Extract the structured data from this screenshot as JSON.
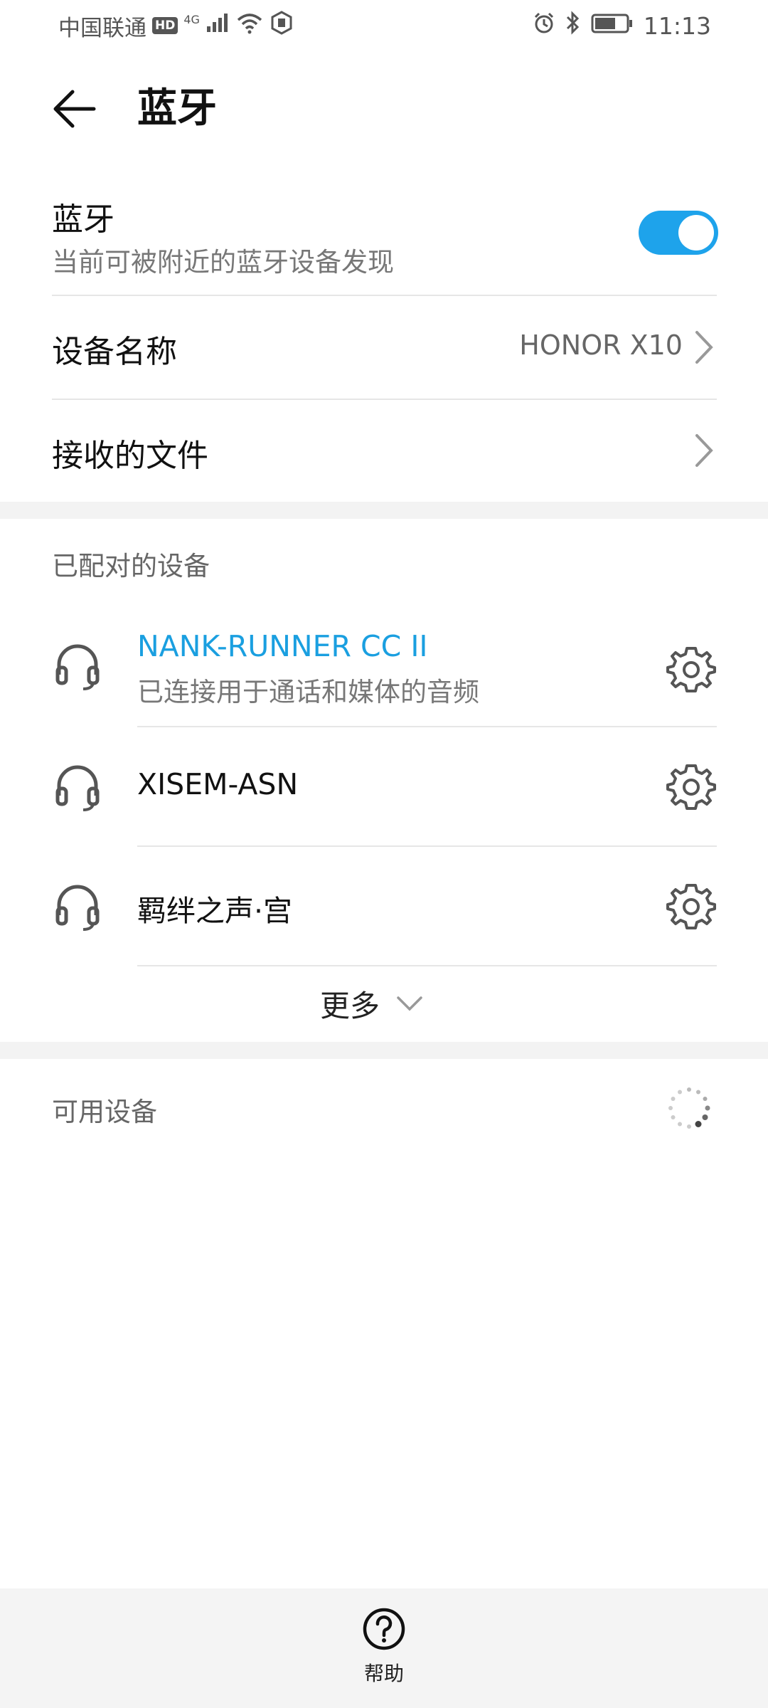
{
  "status_bar": {
    "carrier": "中国联通",
    "hd": "HD",
    "network": "4G",
    "time": "11:13",
    "icons": [
      "signal-icon",
      "wifi-icon",
      "hotspot-icon",
      "alarm-icon",
      "bluetooth-icon",
      "battery-icon"
    ]
  },
  "header": {
    "title": "蓝牙",
    "back_icon": "arrow-left-icon"
  },
  "bluetooth": {
    "label": "蓝牙",
    "subtitle": "当前可被附近的蓝牙设备发现",
    "enabled": true,
    "accent_color": "#1ea3eb"
  },
  "settings": {
    "device_name_label": "设备名称",
    "device_name_value": "HONOR X10",
    "received_files_label": "接收的文件"
  },
  "paired": {
    "header": "已配对的设备",
    "devices": [
      {
        "name": "NANK-RUNNER CC II",
        "status": "已连接用于通话和媒体的音频",
        "icon": "headset-icon"
      },
      {
        "name": "XISEM-ASN",
        "icon": "headset-icon"
      },
      {
        "name": "羁绊之声·宫",
        "icon": "headset-icon"
      }
    ],
    "more_label": "更多"
  },
  "available": {
    "header": "可用设备"
  },
  "bottom": {
    "help_label": "帮助"
  }
}
